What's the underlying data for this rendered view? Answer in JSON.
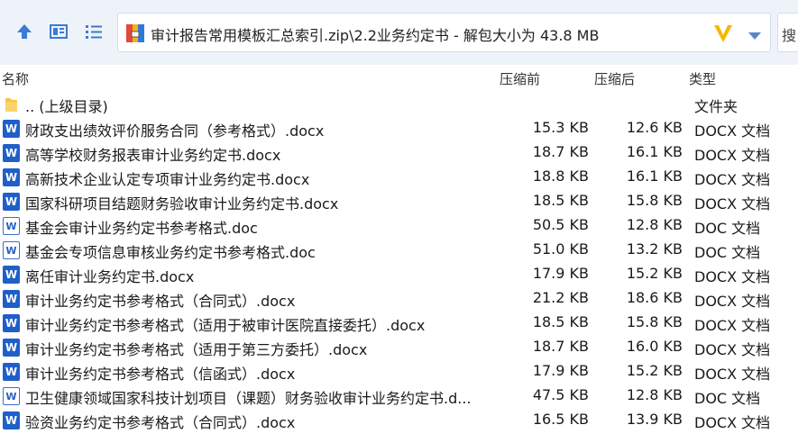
{
  "address": {
    "path": "审计报告常用模板汇总索引.zip\\2.2业务约定书 - 解包大小为 43.8 MB",
    "search_placeholder": "搜"
  },
  "columns": {
    "name": "名称",
    "packed": "压缩前",
    "compressed": "压缩后",
    "type": "类型"
  },
  "parent": {
    "name": ".. (上级目录)",
    "type": "文件夹"
  },
  "files": [
    {
      "name": "财政支出绩效评价服务合同（参考格式）.docx",
      "packed": "15.3 KB",
      "compressed": "12.6 KB",
      "type": "DOCX 文档",
      "icon": "docx"
    },
    {
      "name": "高等学校财务报表审计业务约定书.docx",
      "packed": "18.7 KB",
      "compressed": "16.1 KB",
      "type": "DOCX 文档",
      "icon": "docx"
    },
    {
      "name": "高新技术企业认定专项审计业务约定书.docx",
      "packed": "18.8 KB",
      "compressed": "16.1 KB",
      "type": "DOCX 文档",
      "icon": "docx"
    },
    {
      "name": "国家科研项目结题财务验收审计业务约定书.docx",
      "packed": "18.5 KB",
      "compressed": "15.8 KB",
      "type": "DOCX 文档",
      "icon": "docx"
    },
    {
      "name": "基金会审计业务约定书参考格式.doc",
      "packed": "50.5 KB",
      "compressed": "12.8 KB",
      "type": "DOC 文档",
      "icon": "doc"
    },
    {
      "name": "基金会专项信息审核业务约定书参考格式.doc",
      "packed": "51.0 KB",
      "compressed": "13.2 KB",
      "type": "DOC 文档",
      "icon": "doc"
    },
    {
      "name": "离任审计业务约定书.docx",
      "packed": "17.9 KB",
      "compressed": "15.2 KB",
      "type": "DOCX 文档",
      "icon": "docx"
    },
    {
      "name": "审计业务约定书参考格式（合同式）.docx",
      "packed": "21.2 KB",
      "compressed": "18.6 KB",
      "type": "DOCX 文档",
      "icon": "docx"
    },
    {
      "name": "审计业务约定书参考格式（适用于被审计医院直接委托）.docx",
      "packed": "18.5 KB",
      "compressed": "15.8 KB",
      "type": "DOCX 文档",
      "icon": "docx"
    },
    {
      "name": "审计业务约定书参考格式（适用于第三方委托）.docx",
      "packed": "18.7 KB",
      "compressed": "16.0 KB",
      "type": "DOCX 文档",
      "icon": "docx"
    },
    {
      "name": "审计业务约定书参考格式（信函式）.docx",
      "packed": "17.9 KB",
      "compressed": "15.2 KB",
      "type": "DOCX 文档",
      "icon": "docx"
    },
    {
      "name": "卫生健康领域国家科技计划项目（课题）财务验收审计业务约定书.d...",
      "packed": "47.5 KB",
      "compressed": "12.8 KB",
      "type": "DOC 文档",
      "icon": "doc"
    },
    {
      "name": "验资业务约定书参考格式（合同式）.docx",
      "packed": "16.5 KB",
      "compressed": "13.9 KB",
      "type": "DOCX 文档",
      "icon": "docx"
    }
  ]
}
